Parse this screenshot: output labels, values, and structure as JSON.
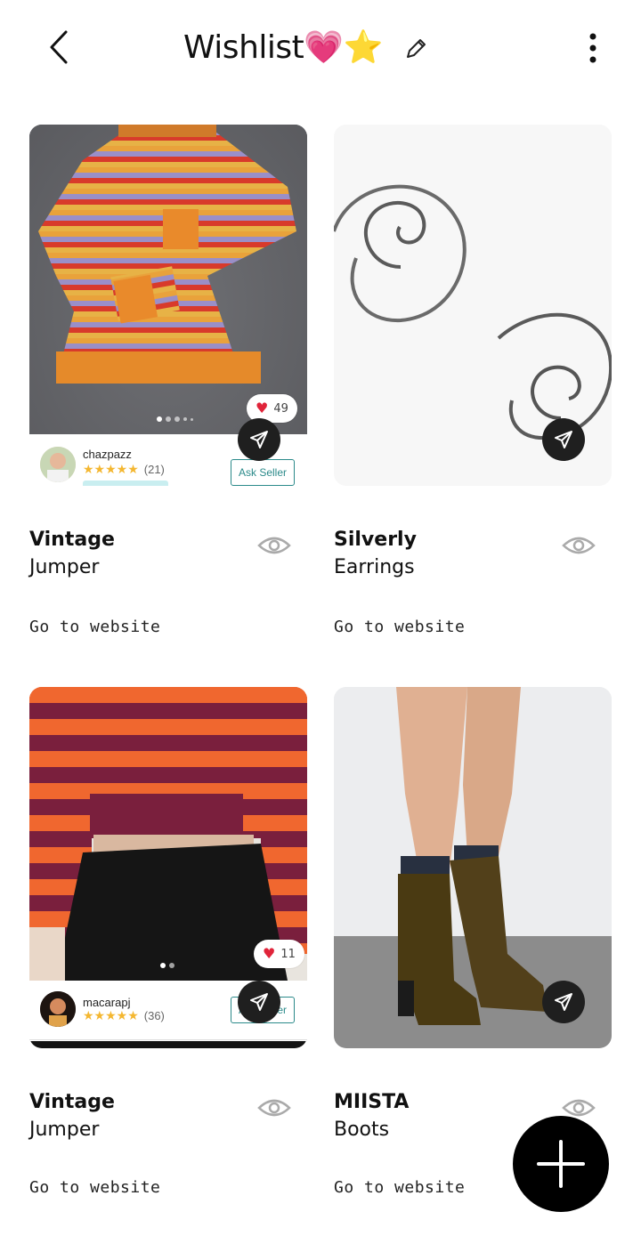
{
  "header": {
    "title": "Wishlist",
    "title_emoji_heart": "💗",
    "title_emoji_star": "⭐"
  },
  "cards": [
    {
      "title": "Vintage",
      "subtitle": "Jumper",
      "link": "Go to website",
      "likes": "49",
      "seller": {
        "name": "chazpazz",
        "stars": "★★★★★",
        "reviews": "(21)"
      },
      "ask_seller": "Ask Seller",
      "photo_dots": 5
    },
    {
      "title": "Silverly",
      "subtitle": "Earrings",
      "link": "Go to website"
    },
    {
      "title": "Vintage",
      "subtitle": "Jumper",
      "link": "Go to website",
      "likes": "11",
      "seller": {
        "name": "macarapj",
        "stars": "★★★★★",
        "reviews": "(36)"
      },
      "ask_seller": "Ask Seller",
      "photo_dots": 2
    },
    {
      "title": "MIISTA",
      "subtitle": "Boots",
      "link": "Go to website"
    }
  ],
  "icons": {
    "back": "back-chevron-icon",
    "edit": "pencil-icon",
    "more": "more-vertical-icon",
    "send": "send-icon",
    "eye": "eye-icon",
    "heart": "heart-icon",
    "add": "plus-icon"
  },
  "colors": {
    "accent_teal": "#2b8a8a",
    "star": "#f4b731",
    "heart": "#e0243a",
    "fab": "#000000"
  }
}
